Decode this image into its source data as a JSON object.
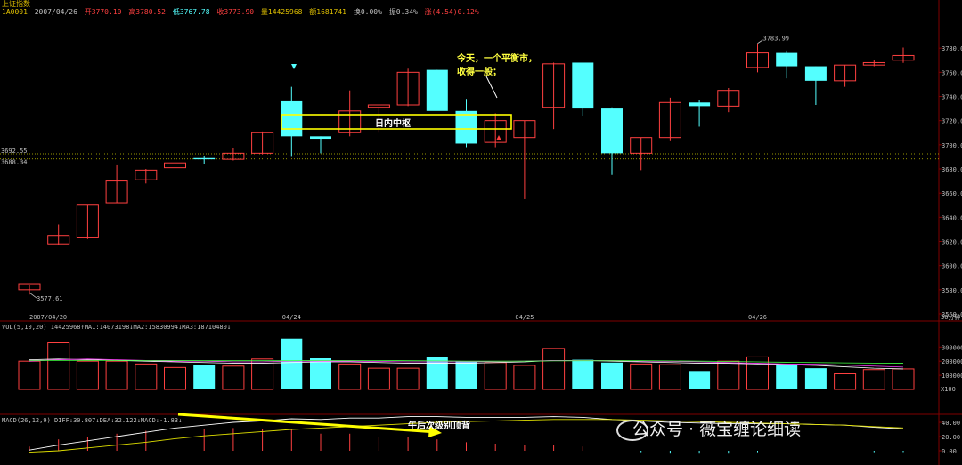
{
  "header": {
    "title": "上证指数",
    "code": "1A0001",
    "date": "2007/04/26",
    "open": "开3770.10",
    "high": "高3780.52",
    "low": "低3767.78",
    "close": "收3773.90",
    "volume": "量14425968",
    "amount": "额1681741",
    "turnover": "换0.00%",
    "amplitude": "振0.34%",
    "change": "涨(4.54)0.12%"
  },
  "colors": {
    "up": "#ff4040",
    "down": "#54ffff",
    "bg": "#000000",
    "grid": "#800000",
    "ma1": "#ffffff",
    "ma2": "#ff40ff",
    "ma3": "#40ff40",
    "annotation": "#ffff40"
  },
  "chart_data": [
    {
      "type": "candlestick",
      "title": "上证指数",
      "ylim": [
        3560,
        3800
      ],
      "y_ticks": [
        "3780.00",
        "3760.00",
        "3740.00",
        "3720.00",
        "3700.00",
        "3680.00",
        "3660.00",
        "3640.00",
        "3620.00",
        "3600.00",
        "3580.00",
        "3560.00"
      ],
      "y_tick_values": [
        3780,
        3760,
        3740,
        3720,
        3700,
        3680,
        3660,
        3640,
        3620,
        3600,
        3580,
        3560
      ],
      "x_labels": [
        {
          "label": "2007/04/20",
          "bar": 0
        },
        {
          "label": "04/24",
          "bar": 9
        },
        {
          "label": "04/25",
          "bar": 17
        },
        {
          "label": "04/26",
          "bar": 25
        }
      ],
      "bar_label": "30分钟",
      "reference_lines": [
        {
          "label": "3692.55",
          "value": 3692.5
        },
        {
          "label": "3688.34",
          "value": 3688.3
        }
      ],
      "extreme_labels": [
        {
          "label": "3577.61",
          "bar": 0,
          "value": 3577.6,
          "pos": "below"
        },
        {
          "label": "3783.99",
          "bar": 25,
          "value": 3783.99,
          "pos": "above"
        }
      ],
      "candles": [
        {
          "o": 3580,
          "h": 3584,
          "l": 3576,
          "c": 3585
        },
        {
          "o": 3618,
          "h": 3634,
          "l": 3617,
          "c": 3625
        },
        {
          "o": 3623,
          "h": 3650,
          "l": 3622,
          "c": 3650
        },
        {
          "o": 3652,
          "h": 3683,
          "l": 3652,
          "c": 3670
        },
        {
          "o": 3671,
          "h": 3680,
          "l": 3668,
          "c": 3679
        },
        {
          "o": 3681,
          "h": 3690,
          "l": 3680,
          "c": 3685
        },
        {
          "o": 3689,
          "h": 3691,
          "l": 3684,
          "c": 3688
        },
        {
          "o": 3688,
          "h": 3697,
          "l": 3687,
          "c": 3693
        },
        {
          "o": 3693,
          "h": 3711,
          "l": 3692,
          "c": 3710
        },
        {
          "o": 3736,
          "h": 3748,
          "l": 3690,
          "c": 3707
        },
        {
          "o": 3707,
          "h": 3707,
          "l": 3693,
          "c": 3705
        },
        {
          "o": 3710,
          "h": 3745,
          "l": 3707,
          "c": 3728
        },
        {
          "o": 3731,
          "h": 3731,
          "l": 3710,
          "c": 3733
        },
        {
          "o": 3733,
          "h": 3763,
          "l": 3732,
          "c": 3760
        },
        {
          "o": 3762,
          "h": 3762,
          "l": 3730,
          "c": 3728
        },
        {
          "o": 3728,
          "h": 3738,
          "l": 3698,
          "c": 3701
        },
        {
          "o": 3702,
          "h": 3726,
          "l": 3698,
          "c": 3720
        },
        {
          "o": 3706,
          "h": 3720,
          "l": 3655,
          "c": 3720
        },
        {
          "o": 3731,
          "h": 3768,
          "l": 3713,
          "c": 3767
        },
        {
          "o": 3768,
          "h": 3768,
          "l": 3724,
          "c": 3730
        },
        {
          "o": 3730,
          "h": 3731,
          "l": 3675,
          "c": 3693
        },
        {
          "o": 3693,
          "h": 3706,
          "l": 3679,
          "c": 3706
        },
        {
          "o": 3706,
          "h": 3739,
          "l": 3703,
          "c": 3735
        },
        {
          "o": 3735,
          "h": 3737,
          "l": 3715,
          "c": 3732
        },
        {
          "o": 3732,
          "h": 3747,
          "l": 3727,
          "c": 3745
        },
        {
          "o": 3764,
          "h": 3784,
          "l": 3760,
          "c": 3776
        },
        {
          "o": 3776,
          "h": 3778,
          "l": 3755,
          "c": 3765
        },
        {
          "o": 3765,
          "h": 3765,
          "l": 3733,
          "c": 3753
        },
        {
          "o": 3753,
          "h": 3766,
          "l": 3748,
          "c": 3766
        },
        {
          "o": 3766,
          "h": 3770,
          "l": 3765,
          "c": 3768
        },
        {
          "o": 3770,
          "h": 3780.5,
          "l": 3767.8,
          "c": 3773.9
        }
      ]
    },
    {
      "type": "bar",
      "title": "VOL(5,10,20) 14425968↑MA1:14073198↓MA2:15830994↓MA3:18710480↓",
      "ylim": [
        0,
        440000
      ],
      "y_ticks": [
        "300000",
        "200000",
        "100000"
      ],
      "y_tick_values": [
        300000,
        200000,
        100000
      ],
      "unit": "X100",
      "values": [
        200000,
        330000,
        200000,
        200000,
        180000,
        155000,
        170000,
        165000,
        215000,
        360000,
        220000,
        180000,
        150000,
        150000,
        230000,
        200000,
        190000,
        170000,
        290000,
        210000,
        190000,
        180000,
        175000,
        130000,
        200000,
        230000,
        170000,
        150000,
        110000,
        140000,
        145000
      ],
      "ma1": [
        210000,
        215000,
        210000,
        205000,
        200000,
        195000,
        190000,
        185000,
        185000,
        190000,
        195000,
        195000,
        190000,
        185000,
        185000,
        185000,
        190000,
        195000,
        205000,
        205000,
        200000,
        195000,
        190000,
        185000,
        185000,
        180000,
        175000,
        170000,
        160000,
        150000,
        145000
      ],
      "ma2": [
        200000,
        210000,
        215000,
        210000,
        205000,
        200000,
        200000,
        195000,
        195000,
        200000,
        200000,
        200000,
        198000,
        195000,
        195000,
        195000,
        198000,
        200000,
        205000,
        205000,
        205000,
        200000,
        198000,
        195000,
        190000,
        185000,
        180000,
        178000,
        172000,
        165000,
        158000
      ],
      "ma3": [
        205000,
        205000,
        205000,
        205000,
        205000,
        205000,
        203000,
        203000,
        203000,
        203000,
        205000,
        205000,
        205000,
        203000,
        202000,
        200000,
        200000,
        200000,
        202000,
        203000,
        203000,
        203000,
        202000,
        200000,
        198000,
        195000,
        192000,
        190000,
        188000,
        186000,
        185000
      ]
    },
    {
      "type": "line",
      "title": "MACD(26,12,9) DIFF:30.807↓DEA:32.122↓MACD:-1.83↓",
      "ylim": [
        -5,
        50
      ],
      "y_ticks": [
        "40.00",
        "20.00",
        "0.00"
      ],
      "y_tick_values": [
        40,
        20,
        0
      ],
      "diff": [
        1,
        8,
        14,
        20,
        26,
        32,
        36,
        40,
        42,
        45,
        44,
        46,
        46,
        48,
        48,
        47,
        47,
        47,
        48,
        47,
        44,
        42,
        40,
        39,
        38,
        38,
        38,
        37,
        36,
        33,
        30.8
      ],
      "dea": [
        -2,
        0,
        4,
        8,
        12,
        17,
        21,
        24,
        27,
        30,
        32,
        34,
        36,
        38,
        40,
        41,
        42,
        43,
        44,
        44,
        44,
        43,
        42,
        41,
        40,
        39,
        38,
        37,
        36,
        34,
        32.1
      ],
      "macd": [
        6,
        16,
        20,
        24,
        28,
        30,
        30,
        32,
        30,
        30,
        24,
        24,
        20,
        20,
        16,
        12,
        10,
        8,
        8,
        6,
        0,
        -2,
        -4,
        -4,
        -4,
        -2,
        0,
        0,
        0,
        -2,
        -1.8
      ]
    }
  ],
  "annotations": {
    "zhongshu": "日内中枢",
    "today_line1": "今天，一个平衡市，",
    "today_line2": "收得一般；",
    "divergence": "午后次级别顶背"
  },
  "watermark": "公众号 · 薇宝缠论细读"
}
